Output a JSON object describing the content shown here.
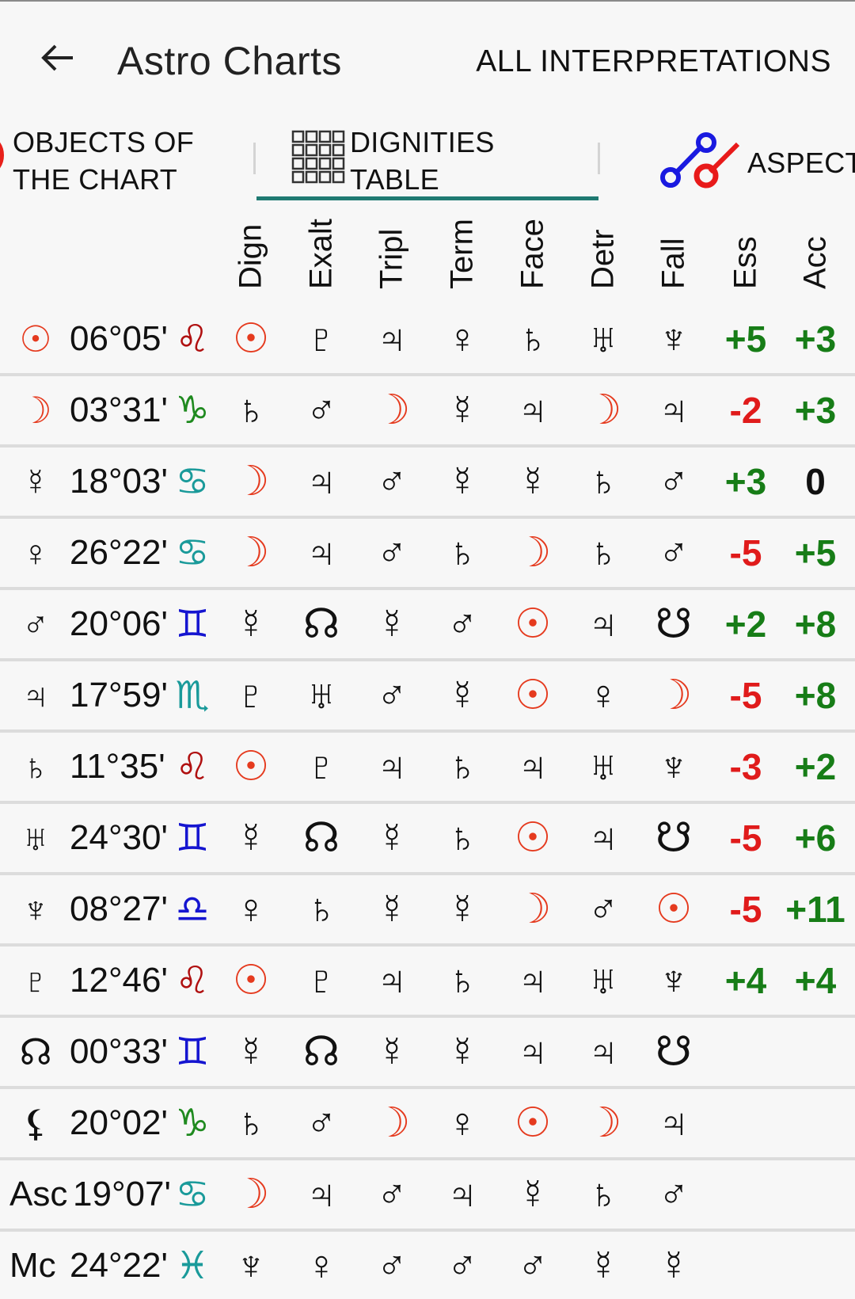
{
  "app": {
    "title": "Astro Charts",
    "action_label": "ALL INTERPRETATIONS",
    "back_icon": "arrow-left-icon"
  },
  "tabs": [
    {
      "label": "OBJECTS OF\nTHE CHART",
      "icon": "sun-circle-icon",
      "active": false
    },
    {
      "label": "DIGNITIES\nTABLE",
      "icon": "grid-icon",
      "active": true
    },
    {
      "label": "ASPECTS",
      "icon": "aspects-nodes-icon",
      "active": false
    }
  ],
  "colors": {
    "accent": "#1f7a72",
    "positive": "#177d17",
    "negative": "#e01b1b",
    "sun_moon": "#e53a1e",
    "leo": "#b01010",
    "capricorn": "#1f8a1f",
    "water": "#1a9a9a",
    "air": "#1515d0"
  },
  "table": {
    "headers": [
      "Dign",
      "Exalt",
      "Tripl",
      "Term",
      "Face",
      "Detr",
      "Fall",
      "Ess",
      "Acc"
    ],
    "rows": [
      {
        "object": "☉",
        "object_name": "sun",
        "degree": "06°05'",
        "sign": "♌",
        "sign_name": "leo",
        "sign_color": "#b01010",
        "cells": [
          "☉",
          "♇",
          "♃",
          "♀",
          "♄",
          "♅",
          "♆"
        ],
        "ess": "+5",
        "acc": "+3"
      },
      {
        "object": "☽",
        "object_name": "moon",
        "degree": "03°31'",
        "sign": "♑",
        "sign_name": "capricorn",
        "sign_color": "#1f8a1f",
        "cells": [
          "♄",
          "♂",
          "☽",
          "☿",
          "♃",
          "☽",
          "♃"
        ],
        "ess": "-2",
        "acc": "+3"
      },
      {
        "object": "☿",
        "object_name": "mercury",
        "degree": "18°03'",
        "sign": "♋",
        "sign_name": "cancer",
        "sign_color": "#1a9a9a",
        "cells": [
          "☽",
          "♃",
          "♂",
          "☿",
          "☿",
          "♄",
          "♂"
        ],
        "ess": "+3",
        "acc": "0"
      },
      {
        "object": "♀",
        "object_name": "venus",
        "degree": "26°22'",
        "sign": "♋",
        "sign_name": "cancer",
        "sign_color": "#1a9a9a",
        "cells": [
          "☽",
          "♃",
          "♂",
          "♄",
          "☽",
          "♄",
          "♂"
        ],
        "ess": "-5",
        "acc": "+5"
      },
      {
        "object": "♂",
        "object_name": "mars",
        "degree": "20°06'",
        "sign": "♊",
        "sign_name": "gemini",
        "sign_color": "#1515d0",
        "cells": [
          "☿",
          "☊",
          "☿",
          "♂",
          "☉",
          "♃",
          "☋"
        ],
        "ess": "+2",
        "acc": "+8"
      },
      {
        "object": "♃",
        "object_name": "jupiter",
        "degree": "17°59'",
        "sign": "♏",
        "sign_name": "scorpio",
        "sign_color": "#1a9a9a",
        "cells": [
          "♇",
          "♅",
          "♂",
          "☿",
          "☉",
          "♀",
          "☽"
        ],
        "ess": "-5",
        "acc": "+8"
      },
      {
        "object": "♄",
        "object_name": "saturn",
        "degree": "11°35'",
        "sign": "♌",
        "sign_name": "leo",
        "sign_color": "#b01010",
        "cells": [
          "☉",
          "♇",
          "♃",
          "♄",
          "♃",
          "♅",
          "♆"
        ],
        "ess": "-3",
        "acc": "+2"
      },
      {
        "object": "♅",
        "object_name": "uranus",
        "degree": "24°30'",
        "sign": "♊",
        "sign_name": "gemini",
        "sign_color": "#1515d0",
        "cells": [
          "☿",
          "☊",
          "☿",
          "♄",
          "☉",
          "♃",
          "☋"
        ],
        "ess": "-5",
        "acc": "+6"
      },
      {
        "object": "♆",
        "object_name": "neptune",
        "degree": "08°27'",
        "sign": "♎",
        "sign_name": "libra",
        "sign_color": "#1515d0",
        "cells": [
          "♀",
          "♄",
          "☿",
          "☿",
          "☽",
          "♂",
          "☉"
        ],
        "ess": "-5",
        "acc": "+11"
      },
      {
        "object": "♇",
        "object_name": "pluto",
        "degree": "12°46'",
        "sign": "♌",
        "sign_name": "leo",
        "sign_color": "#b01010",
        "cells": [
          "☉",
          "♇",
          "♃",
          "♄",
          "♃",
          "♅",
          "♆"
        ],
        "ess": "+4",
        "acc": "+4"
      },
      {
        "object": "☊",
        "object_name": "north-node",
        "degree": "00°33'",
        "sign": "♊",
        "sign_name": "gemini",
        "sign_color": "#1515d0",
        "cells": [
          "☿",
          "☊",
          "☿",
          "☿",
          "♃",
          "♃",
          "☋"
        ],
        "ess": "",
        "acc": ""
      },
      {
        "object": "⚸",
        "object_name": "lilith",
        "degree": "20°02'",
        "sign": "♑",
        "sign_name": "capricorn",
        "sign_color": "#1f8a1f",
        "cells": [
          "♄",
          "♂",
          "☽",
          "♀",
          "☉",
          "☽",
          "♃"
        ],
        "ess": "",
        "acc": ""
      },
      {
        "object": "Asc",
        "object_name": "ascendant",
        "degree": "19°07'",
        "sign": "♋",
        "sign_name": "cancer",
        "sign_color": "#1a9a9a",
        "cells": [
          "☽",
          "♃",
          "♂",
          "♃",
          "☿",
          "♄",
          "♂"
        ],
        "ess": "",
        "acc": ""
      },
      {
        "object": "Mc",
        "object_name": "midheaven",
        "degree": "24°22'",
        "sign": "♓",
        "sign_name": "pisces",
        "sign_color": "#1a9a9a",
        "cells": [
          "♆",
          "♀",
          "♂",
          "♂",
          "♂",
          "☿",
          "☿"
        ],
        "ess": "",
        "acc": ""
      }
    ]
  }
}
